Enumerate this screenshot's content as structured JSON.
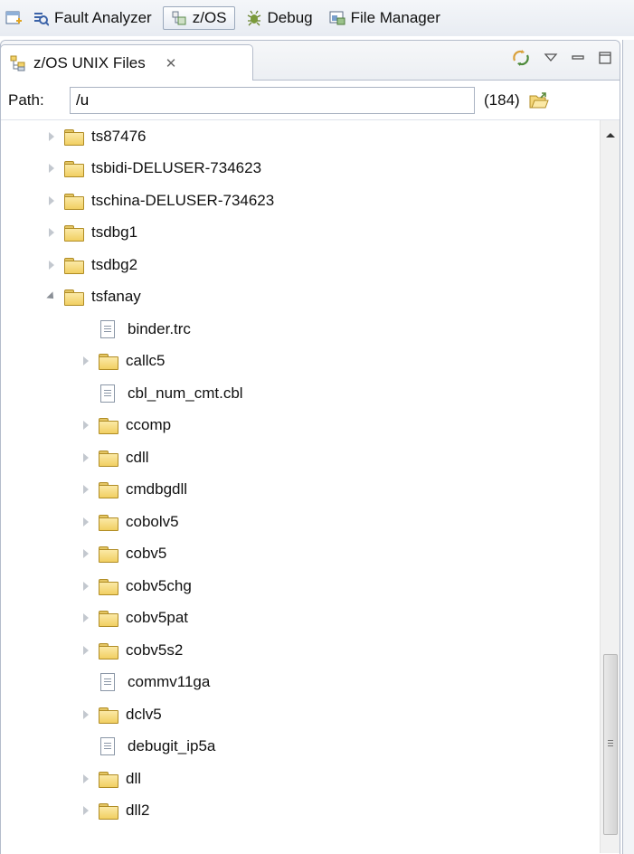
{
  "perspectives": [
    {
      "label": "Fault Analyzer",
      "icon": "fault-analyzer-icon",
      "active": false
    },
    {
      "label": "z/OS",
      "icon": "zos-perspective-icon",
      "active": true
    },
    {
      "label": "Debug",
      "icon": "debug-bug-icon",
      "active": false
    },
    {
      "label": "File Manager",
      "icon": "file-manager-icon",
      "active": false
    }
  ],
  "view": {
    "tab_label": "z/OS UNIX Files",
    "tab_icon": "unix-files-icon",
    "close_glyph": "✕"
  },
  "path_bar": {
    "label": "Path:",
    "value": "/u",
    "count": "(184)"
  },
  "tree": {
    "top_level": [
      "ts87476",
      "tsbidi-DELUSER-734623",
      "tschina-DELUSER-734623",
      "tsdbg1",
      "tsdbg2"
    ],
    "expanded": {
      "name": "tsfanay",
      "children": [
        {
          "name": "binder.trc",
          "type": "file"
        },
        {
          "name": "callc5",
          "type": "folder"
        },
        {
          "name": "cbl_num_cmt.cbl",
          "type": "file"
        },
        {
          "name": "ccomp",
          "type": "folder"
        },
        {
          "name": "cdll",
          "type": "folder"
        },
        {
          "name": "cmdbgdll",
          "type": "folder"
        },
        {
          "name": "cobolv5",
          "type": "folder"
        },
        {
          "name": "cobv5",
          "type": "folder"
        },
        {
          "name": "cobv5chg",
          "type": "folder"
        },
        {
          "name": "cobv5pat",
          "type": "folder"
        },
        {
          "name": "cobv5s2",
          "type": "folder"
        },
        {
          "name": "commv11ga",
          "type": "file"
        },
        {
          "name": "dclv5",
          "type": "folder"
        },
        {
          "name": "debugit_ip5a",
          "type": "file"
        },
        {
          "name": "dll",
          "type": "folder"
        },
        {
          "name": "dll2",
          "type": "folder"
        }
      ]
    }
  }
}
